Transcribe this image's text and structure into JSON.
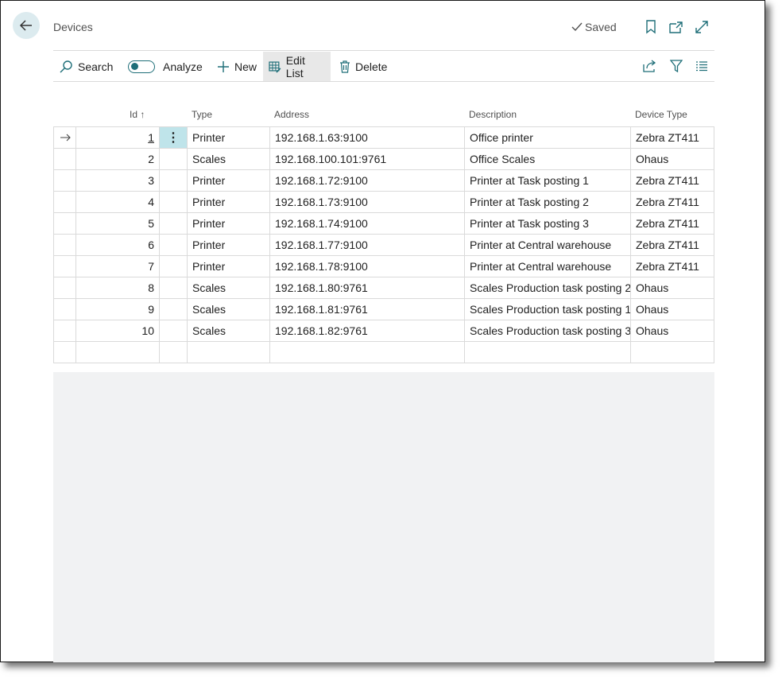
{
  "header": {
    "title": "Devices",
    "saved_label": "Saved"
  },
  "actions": {
    "search": "Search",
    "analyze": "Analyze",
    "new": "New",
    "edit_list": "Edit List",
    "delete": "Delete"
  },
  "table": {
    "columns": {
      "id": "Id",
      "type": "Type",
      "address": "Address",
      "description": "Description",
      "device_type": "Device Type"
    },
    "sort_indicator": "↑",
    "rows": [
      {
        "id": "1",
        "type": "Printer",
        "address": "192.168.1.63:9100",
        "description": "Office printer",
        "device_type": "Zebra ZT411"
      },
      {
        "id": "2",
        "type": "Scales",
        "address": "192.168.100.101:9761",
        "description": "Office Scales",
        "device_type": "Ohaus"
      },
      {
        "id": "3",
        "type": "Printer",
        "address": "192.168.1.72:9100",
        "description": "Printer at Task posting 1",
        "device_type": "Zebra ZT411"
      },
      {
        "id": "4",
        "type": "Printer",
        "address": "192.168.1.73:9100",
        "description": "Printer at Task posting 2",
        "device_type": "Zebra ZT411"
      },
      {
        "id": "5",
        "type": "Printer",
        "address": "192.168.1.74:9100",
        "description": "Printer at Task posting 3",
        "device_type": "Zebra ZT411"
      },
      {
        "id": "6",
        "type": "Printer",
        "address": "192.168.1.77:9100",
        "description": "Printer at Central warehouse",
        "device_type": "Zebra ZT411"
      },
      {
        "id": "7",
        "type": "Printer",
        "address": "192.168.1.78:9100",
        "description": "Printer at Central warehouse",
        "device_type": "Zebra ZT411"
      },
      {
        "id": "8",
        "type": "Scales",
        "address": "192.168.1.80:9761",
        "description": "Scales Production task posting 2",
        "device_type": "Ohaus"
      },
      {
        "id": "9",
        "type": "Scales",
        "address": "192.168.1.81:9761",
        "description": "Scales Production task posting 1",
        "device_type": "Ohaus"
      },
      {
        "id": "10",
        "type": "Scales",
        "address": "192.168.1.82:9761",
        "description": "Scales Production task posting 3",
        "device_type": "Ohaus"
      }
    ]
  },
  "colors": {
    "accent": "#1e6e78",
    "selected_cell": "#bfe4ea",
    "back_button_bg": "#dcebef",
    "empty_area": "#f1f2f3"
  }
}
